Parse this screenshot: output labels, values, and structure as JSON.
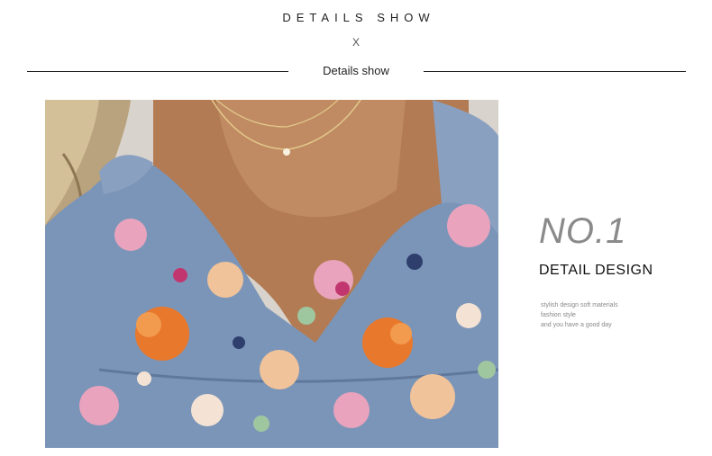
{
  "header": {
    "title": "DETAILS SHOW",
    "close_mark": "X",
    "subtitle": "Details show"
  },
  "product_image": {
    "description_icon": "floral-top-closeup"
  },
  "detail": {
    "number": "NO.1",
    "heading": "DETAIL DESIGN",
    "lines": [
      "stylish design soft materials",
      "fashion style",
      "and you have a good day"
    ]
  },
  "colors": {
    "background": "#ffffff",
    "rule": "#222222",
    "number": "#8a8a8a",
    "fabric_base": "#7b95b8",
    "flower_pink": "#e9a3bd",
    "flower_orange": "#e8782c",
    "flower_peach": "#f0c39a",
    "skin": "#b07a52"
  }
}
